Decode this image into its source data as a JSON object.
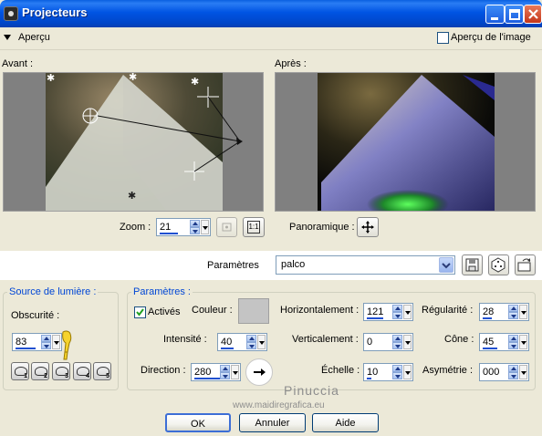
{
  "window": {
    "title": "Projecteurs"
  },
  "preview_bar": {
    "toggle_label": "Aperçu",
    "image_preview_label": "Aperçu de l'image"
  },
  "before": {
    "label": "Avant :"
  },
  "after": {
    "label": "Après :"
  },
  "zoom": {
    "label": "Zoom :",
    "value": "21",
    "one_to_one": "1:1"
  },
  "pan": {
    "label": "Panoramique :"
  },
  "presets": {
    "label": "Paramètres",
    "value": "palco"
  },
  "light_source": {
    "title": "Source de lumière :",
    "darkness_label": "Obscurité :",
    "darkness_value": "83",
    "presets": [
      "1",
      "2",
      "3",
      "4",
      "5"
    ]
  },
  "params": {
    "title": "Paramètres :",
    "enabled_label": "Activés",
    "color_label": "Couleur :",
    "color": "#c4c4c4",
    "intensity_label": "Intensité :",
    "intensity_value": "40",
    "direction_label": "Direction :",
    "direction_value": "280",
    "horizontal_label": "Horizontalement :",
    "horizontal_value": "121",
    "vertical_label": "Verticalement :",
    "vertical_value": "0",
    "scale_label": "Échelle :",
    "scale_value": "10",
    "regularity_label": "Régularité :",
    "regularity_value": "28",
    "cone_label": "Cône :",
    "cone_value": "45",
    "asymmetry_label": "Asymétrie :",
    "asymmetry_value": "000"
  },
  "watermark": {
    "line1": "Pinuccia",
    "line2": "www.maidiregrafica.eu"
  },
  "buttons": {
    "ok": "OK",
    "cancel": "Annuler",
    "help": "Aide"
  },
  "colors": {
    "titlebar": "#0054e3",
    "dialog_bg": "#ece9d8",
    "group_title": "#0046d5"
  }
}
